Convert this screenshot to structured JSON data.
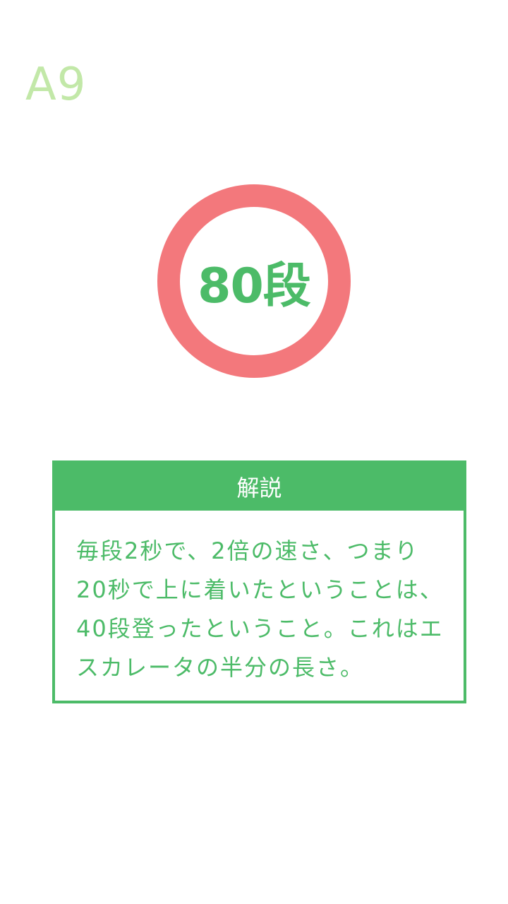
{
  "question": {
    "number": "A9"
  },
  "answer": {
    "text": "80段"
  },
  "explanation": {
    "title": "解説",
    "lines": [
      "毎段2秒で、2倍の速さ、つまり",
      "20秒で上に着いたということは、",
      "40段登ったということ。これはエ",
      "スカレータの半分の長さ。"
    ]
  },
  "colors": {
    "ring": "#f3787c",
    "accent_green": "#4cbb68",
    "question_number": "#c2e8a8",
    "background": "#ffffff"
  }
}
